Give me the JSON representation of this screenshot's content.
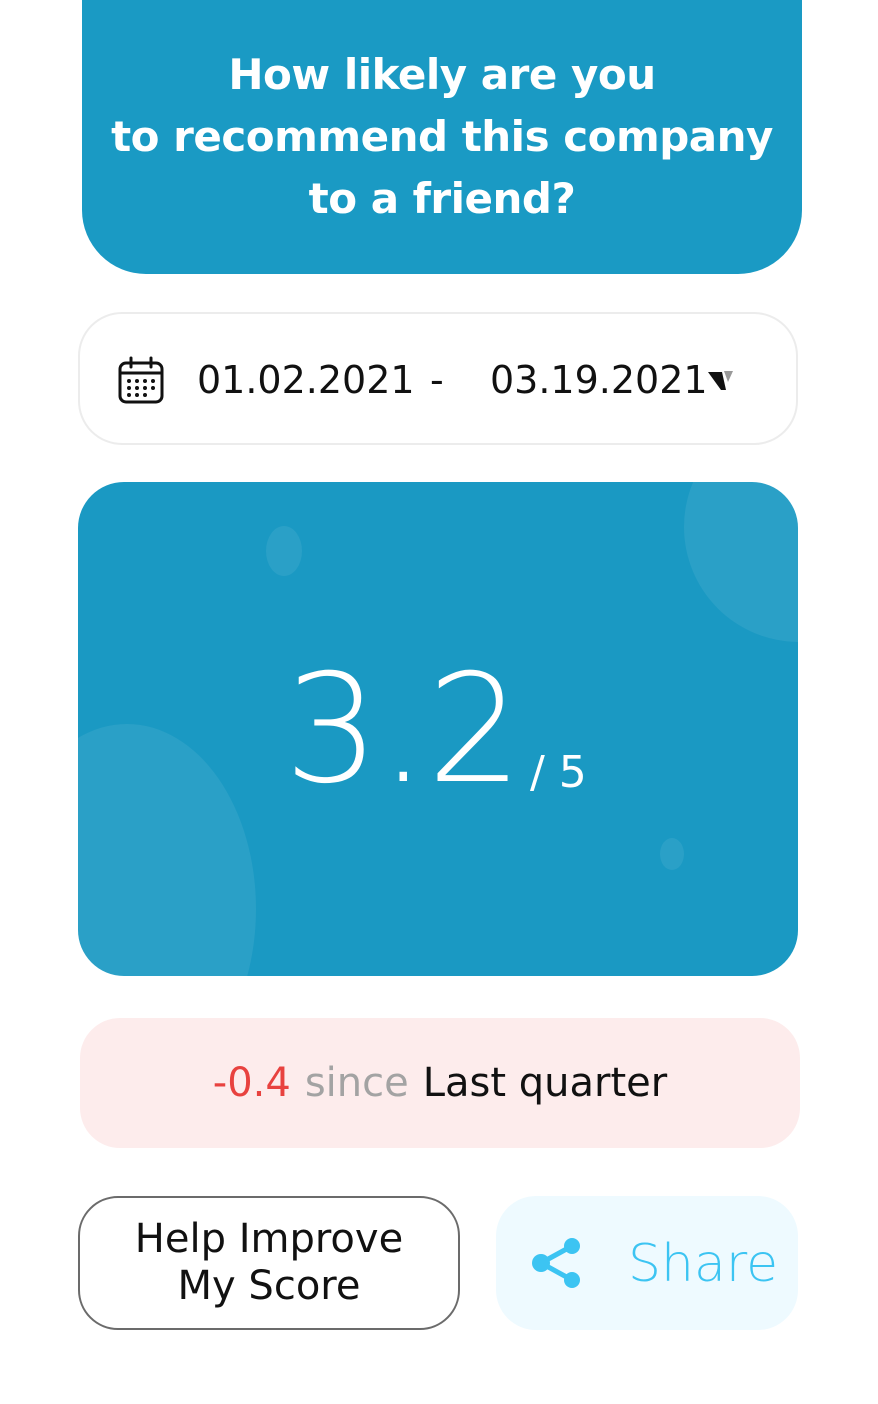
{
  "question": {
    "lines": [
      "How likely are you",
      "to recommend this company",
      "to a friend?"
    ]
  },
  "date_range": {
    "start": "01.02.2021",
    "separator": "-",
    "end": "03.19.2021",
    "icon": "calendar-icon",
    "dropdown_icon": "chevron-down-icon"
  },
  "score": {
    "value": "3.2",
    "max_label": "/ 5"
  },
  "change": {
    "value": "-0.4",
    "since_label": "since",
    "period": "Last quarter",
    "value_color": "#e8423f"
  },
  "actions": {
    "help_label_line1": "Help Improve",
    "help_label_line2": "My Score",
    "share_label": "Share",
    "share_icon": "share-icon"
  },
  "colors": {
    "primary": "#1a9ac4",
    "share_accent": "#3cc4f2",
    "negative_bg": "#fdecec"
  }
}
